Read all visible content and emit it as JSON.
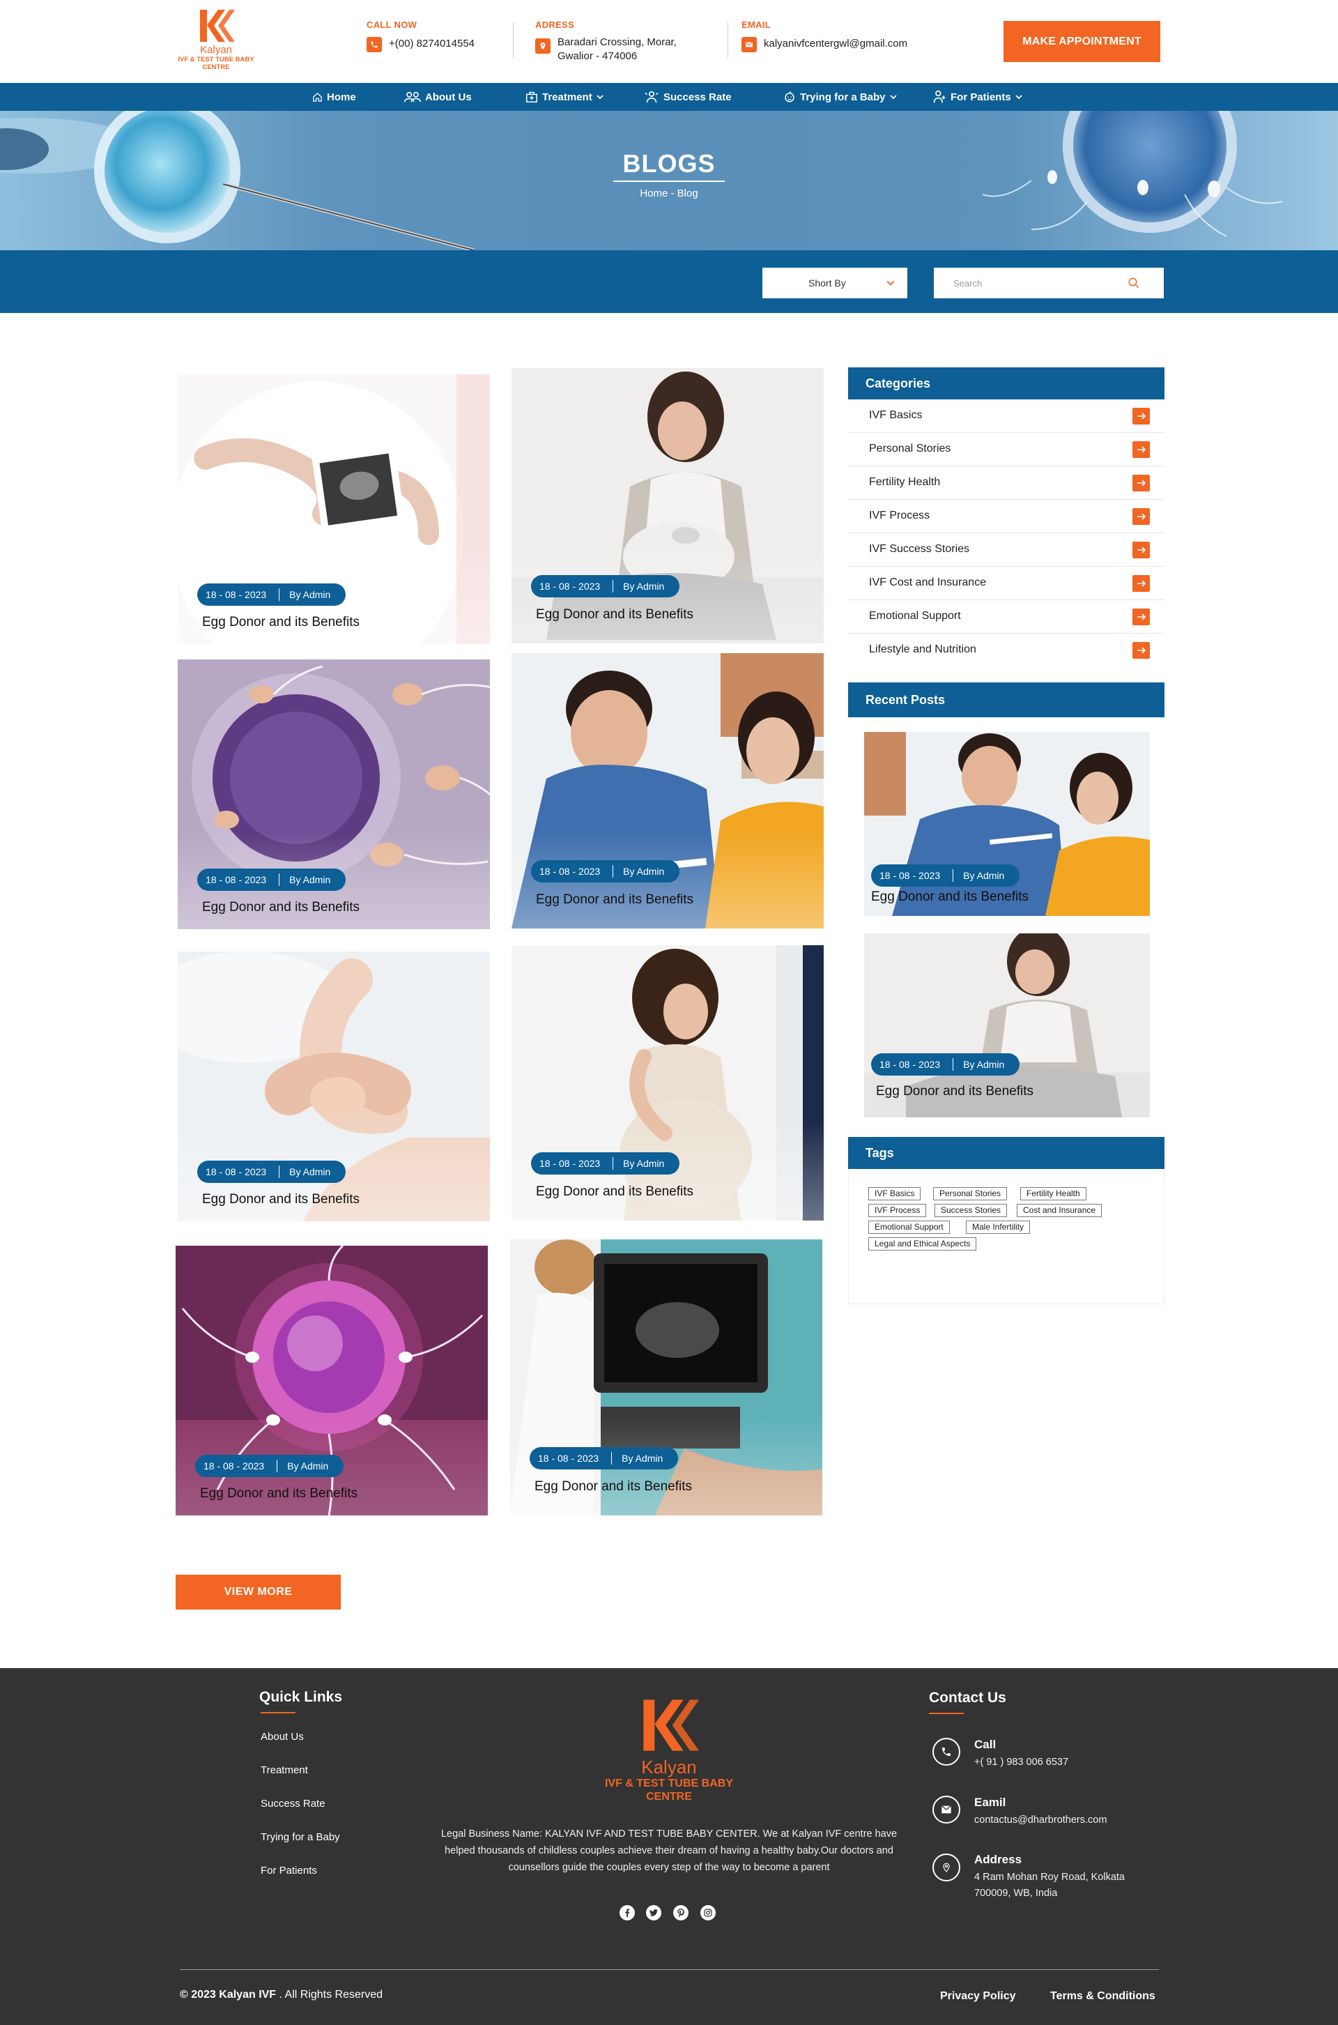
{
  "brand": {
    "name": "Kalyan",
    "subtitle": "IVF & TEST TUBE BABY CENTRE",
    "footer_subtitle_line1": "IVF & TEST TUBE BABY",
    "footer_subtitle_line2": "CENTRE",
    "accent_color": "#f26522",
    "primary_color": "#0d5f96"
  },
  "header": {
    "call": {
      "label": "CALL NOW",
      "value": "+(00) 8274014554",
      "icon": "phone-icon"
    },
    "address": {
      "label": "ADRESS",
      "line1": "Baradari Crossing, Morar,",
      "line2": "Gwalior - 474006",
      "icon": "location-icon"
    },
    "email": {
      "label": "EMAIL",
      "value": "kalyanivfcentergwl@gmail.com",
      "icon": "mail-icon"
    },
    "cta": "MAKE APPOINTMENT"
  },
  "nav": [
    {
      "label": "Home",
      "icon": "home-icon"
    },
    {
      "label": "About Us",
      "icon": "people-icon"
    },
    {
      "label": "Treatment",
      "icon": "hospital-icon",
      "dropdown": true
    },
    {
      "label": "Success Rate",
      "icon": "award-icon"
    },
    {
      "label": "Trying for a Baby",
      "icon": "baby-icon",
      "dropdown": true
    },
    {
      "label": "For Patients",
      "icon": "patient-icon",
      "dropdown": true
    }
  ],
  "hero": {
    "title": "BLOGS",
    "breadcrumb": "Home - Blog"
  },
  "filters": {
    "sort_label": "Short By",
    "search_placeholder": "Search"
  },
  "posts": [
    {
      "date": "18 - 08 - 2023",
      "author": "By Admin",
      "title": "Egg Donor and its Benefits"
    },
    {
      "date": "18 - 08 - 2023",
      "author": "By Admin",
      "title": "Egg Donor and its Benefits"
    },
    {
      "date": "18 - 08 - 2023",
      "author": "By Admin",
      "title": "Egg Donor and its Benefits"
    },
    {
      "date": "18 - 08 - 2023",
      "author": "By Admin",
      "title": "Egg Donor and its Benefits"
    },
    {
      "date": "18 - 08 - 2023",
      "author": "By Admin",
      "title": "Egg Donor and its Benefits"
    },
    {
      "date": "18 - 08 - 2023",
      "author": "By Admin",
      "title": "Egg Donor and its Benefits"
    },
    {
      "date": "18 - 08 - 2023",
      "author": "By Admin",
      "title": "Egg Donor and its Benefits"
    },
    {
      "date": "18 - 08 - 2023",
      "author": "By Admin",
      "title": "Egg Donor and its Benefits"
    }
  ],
  "view_more": "VIEW MORE",
  "sidebar": {
    "categories_title": "Categories",
    "categories": [
      "IVF Basics",
      "Personal Stories",
      "Fertility Health",
      "IVF Process",
      "IVF Success Stories",
      "IVF Cost and Insurance",
      "Emotional Support",
      "Lifestyle and Nutrition"
    ],
    "recent_title": "Recent Posts",
    "recent": [
      {
        "date": "18 - 08 - 2023",
        "author": "By Admin",
        "title": "Egg Donor and its Benefits"
      },
      {
        "date": "18 - 08 - 2023",
        "author": "By Admin",
        "title": "Egg Donor and its Benefits"
      }
    ],
    "tags_title": "Tags",
    "tags": [
      "IVF Basics",
      "Personal Stories",
      "Fertility Health",
      "IVF Process",
      "Success Stories",
      "Cost and Insurance",
      "Emotional Support",
      "Male Infertility",
      "Legal and Ethical Aspects"
    ]
  },
  "footer": {
    "quick_links_title": "Quick Links",
    "quick_links": [
      "About Us",
      "Treatment",
      "Success Rate",
      "Trying for a Baby",
      "For Patients"
    ],
    "description": "Legal Business Name: KALYAN IVF AND TEST TUBE BABY CENTER. We at Kalyan IVF centre have helped thousands of childless couples achieve their dream of having a healthy baby.Our doctors and counsellors guide the couples every step of the way to become a parent",
    "social": [
      "facebook-icon",
      "twitter-icon",
      "pinterest-icon",
      "instagram-icon"
    ],
    "contact_title": "Contact Us",
    "contact": {
      "call_label": "Call",
      "call_value": "+( 91 ) 983 006 6537",
      "email_label": "Eamil",
      "email_value": "contactus@dharbrothers.com",
      "address_label": "Address",
      "address_value": "4 Ram Mohan Roy Road, Kolkata 700009, WB, India"
    },
    "copyright_brand": "© 2023 Kalyan IVF",
    "copyright_rest": " . All Rights Reserved",
    "privacy": "Privacy Policy",
    "terms": "Terms & Conditions"
  }
}
